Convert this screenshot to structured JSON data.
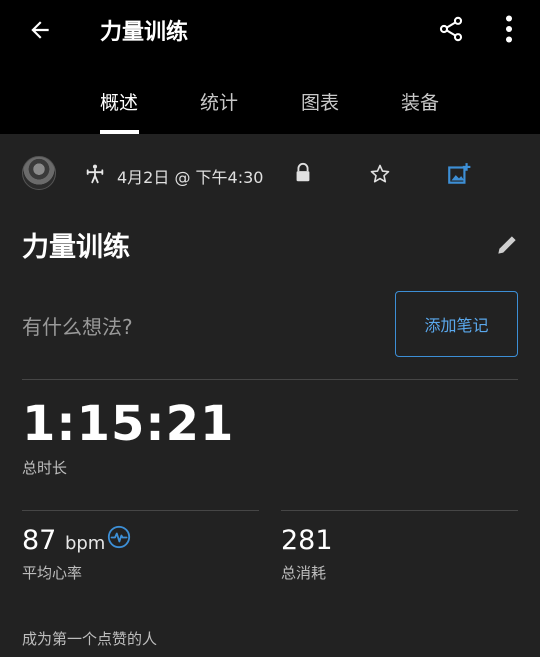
{
  "header": {
    "title": "力量训练",
    "icons": {
      "back": "arrow-left-icon",
      "share": "share-icon",
      "more": "more-vertical-icon"
    }
  },
  "tabs": [
    {
      "label": "概述",
      "active": true
    },
    {
      "label": "统计",
      "active": false
    },
    {
      "label": "图表",
      "active": false
    },
    {
      "label": "装备",
      "active": false
    }
  ],
  "meta": {
    "date": "4月2日 @ 下午4:30",
    "icons": {
      "activity": "strength-training-icon",
      "privacy": "lock-icon",
      "favorite": "star-outline-icon",
      "media": "add-photo-icon"
    }
  },
  "workout": {
    "title": "力量训练",
    "thoughts_placeholder": "有什么想法?",
    "add_note_label": "添加笔记"
  },
  "stats": {
    "duration": {
      "value": "1:15:21",
      "label": "总时长"
    },
    "heart_rate": {
      "value": "87",
      "unit": "bpm",
      "label": "平均心率",
      "icon": "heart-rate-icon"
    },
    "calories": {
      "value": "281",
      "label": "总消耗"
    }
  },
  "kudos": "成为第一个点赞的人",
  "colors": {
    "accent": "#3d8fd6",
    "background": "#222222",
    "header": "#000000"
  }
}
